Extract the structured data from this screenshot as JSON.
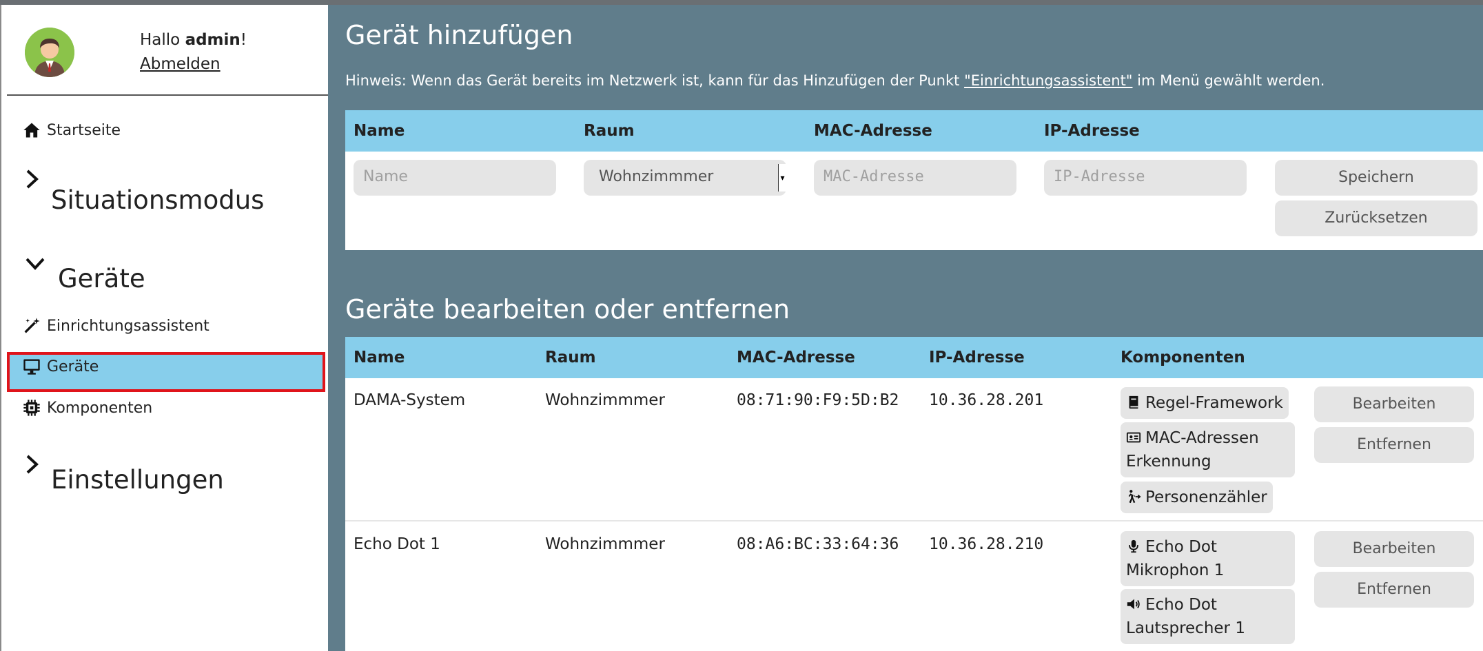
{
  "user": {
    "greeting_prefix": "Hallo ",
    "name": "admin",
    "greeting_suffix": "!",
    "logout": "Abmelden"
  },
  "nav": {
    "home": "Startseite",
    "situations": "Situationsmodus",
    "devices_section": "Geräte",
    "wizard": "Einrichtungsassistent",
    "devices": "Geräte",
    "components": "Komponenten",
    "settings": "Einstellungen"
  },
  "add": {
    "title": "Gerät hinzufügen",
    "hint_prefix": "Hinweis: Wenn das Gerät bereits im Netzwerk ist, kann für das Hinzufügen der Punkt ",
    "hint_link": "\"Einrichtungsassistent\"",
    "hint_suffix": " im Menü gewählt werden.",
    "headers": {
      "name": "Name",
      "room": "Raum",
      "mac": "MAC-Adresse",
      "ip": "IP-Adresse"
    },
    "name_placeholder": "Name",
    "room_value": "Wohnzimmmer",
    "mac_placeholder": "MAC-Adresse",
    "ip_placeholder": "IP-Adresse",
    "save": "Speichern",
    "reset": "Zurücksetzen"
  },
  "edit": {
    "title": "Geräte bearbeiten oder entfernen",
    "headers": {
      "name": "Name",
      "room": "Raum",
      "mac": "MAC-Adresse",
      "ip": "IP-Adresse",
      "components": "Komponenten"
    },
    "edit_label": "Bearbeiten",
    "remove_label": "Entfernen",
    "rows": [
      {
        "name": "DAMA-System",
        "room": "Wohnzimmmer",
        "mac": "08:71:90:F9:5D:B2",
        "ip": "10.36.28.201",
        "components": [
          {
            "icon": "book-icon",
            "label": "Regel-Framework"
          },
          {
            "icon": "id-card-icon",
            "label_1": "MAC-Adressen",
            "label_2": "Erkennung"
          },
          {
            "icon": "person-walking-icon",
            "label": "Personenzähler"
          }
        ]
      },
      {
        "name": "Echo Dot 1",
        "room": "Wohnzimmmer",
        "mac": "08:A6:BC:33:64:36",
        "ip": "10.36.28.210",
        "components": [
          {
            "icon": "microphone-icon",
            "label_1": "Echo Dot",
            "label_2": "Mikrophon 1"
          },
          {
            "icon": "speaker-icon",
            "label_1": "Echo Dot",
            "label_2": "Lautsprecher 1"
          }
        ]
      }
    ]
  }
}
